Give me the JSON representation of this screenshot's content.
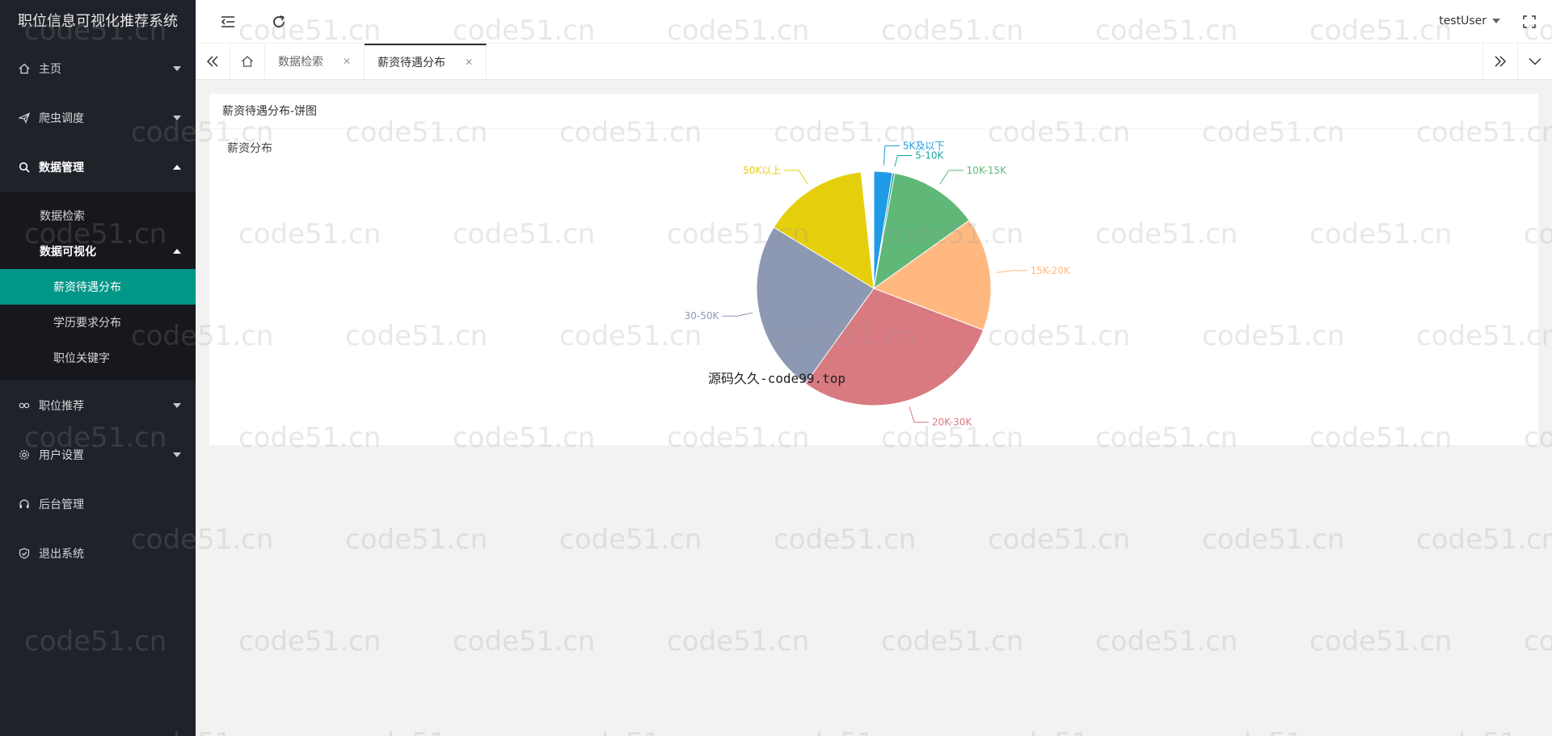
{
  "app": {
    "title": "职位信息可视化推荐系统"
  },
  "sidebar": {
    "items": [
      {
        "label": "主页"
      },
      {
        "label": "爬虫调度"
      },
      {
        "label": "数据管理",
        "children": [
          "数据检索"
        ],
        "sub": {
          "label": "数据可视化",
          "children": [
            "薪资待遇分布",
            "学历要求分布",
            "职位关键字"
          ]
        }
      },
      {
        "label": "职位推荐"
      },
      {
        "label": "用户设置"
      },
      {
        "label": "后台管理"
      },
      {
        "label": "退出系统"
      }
    ]
  },
  "header": {
    "user": "testUser"
  },
  "tabs": [
    {
      "label": "数据检索"
    },
    {
      "label": "薪资待遇分布"
    }
  ],
  "card": {
    "title": "薪资待遇分布-饼图"
  },
  "chart_data": {
    "type": "pie",
    "title": "薪资分布",
    "slices": [
      {
        "label": "5K及以下",
        "value": 2.5,
        "color": "#1f9be6"
      },
      {
        "label": "5-10K",
        "value": 0.3,
        "color": "#1aa59b"
      },
      {
        "label": "10K-15K",
        "value": 12,
        "color": "#5fb878"
      },
      {
        "label": "15K-20K",
        "value": 15.3,
        "color": "#ffb980"
      },
      {
        "label": "20K-30K",
        "value": 28.5,
        "color": "#d87a80"
      },
      {
        "label": "30-50K",
        "value": 23.3,
        "color": "#8d98b3"
      },
      {
        "label": "50K以上",
        "value": 14.2,
        "color": "#e5cf0d"
      },
      {
        "label": "",
        "value": 1.7,
        "color": "#ffffff"
      }
    ]
  },
  "overlay_text": "源码久久-code99.top",
  "watermark_text": "code51.cn",
  "colors": {
    "sidebar": "#20222a",
    "active": "#009688"
  }
}
